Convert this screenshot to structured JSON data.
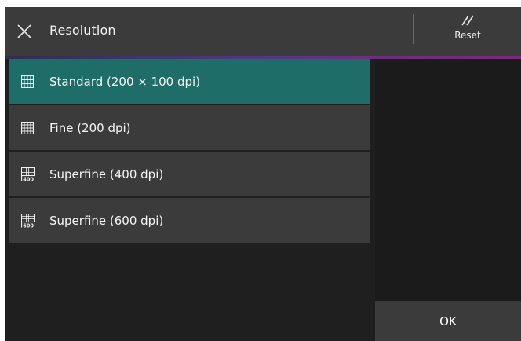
{
  "header": {
    "title": "Resolution",
    "close_icon": "close-x-icon",
    "reset_label": "Reset",
    "reset_icon": "double-slash-icon",
    "accent_color": "#6b2f7e"
  },
  "options": [
    {
      "label": "Standard (200 × 100 dpi)",
      "icon": "grid-icon",
      "selected": true
    },
    {
      "label": "Fine (200 dpi)",
      "icon": "grid-fine-icon",
      "selected": false
    },
    {
      "label": "Superfine (400 dpi)",
      "icon": "grid-400-icon",
      "badge": "400",
      "selected": false
    },
    {
      "label": "Superfine (600 dpi)",
      "icon": "grid-600-icon",
      "badge": "600",
      "selected": false
    }
  ],
  "footer": {
    "ok_label": "OK"
  },
  "colors": {
    "selected": "#1e6d68",
    "button": "#3b3b3c",
    "background": "#1f1f1f"
  }
}
